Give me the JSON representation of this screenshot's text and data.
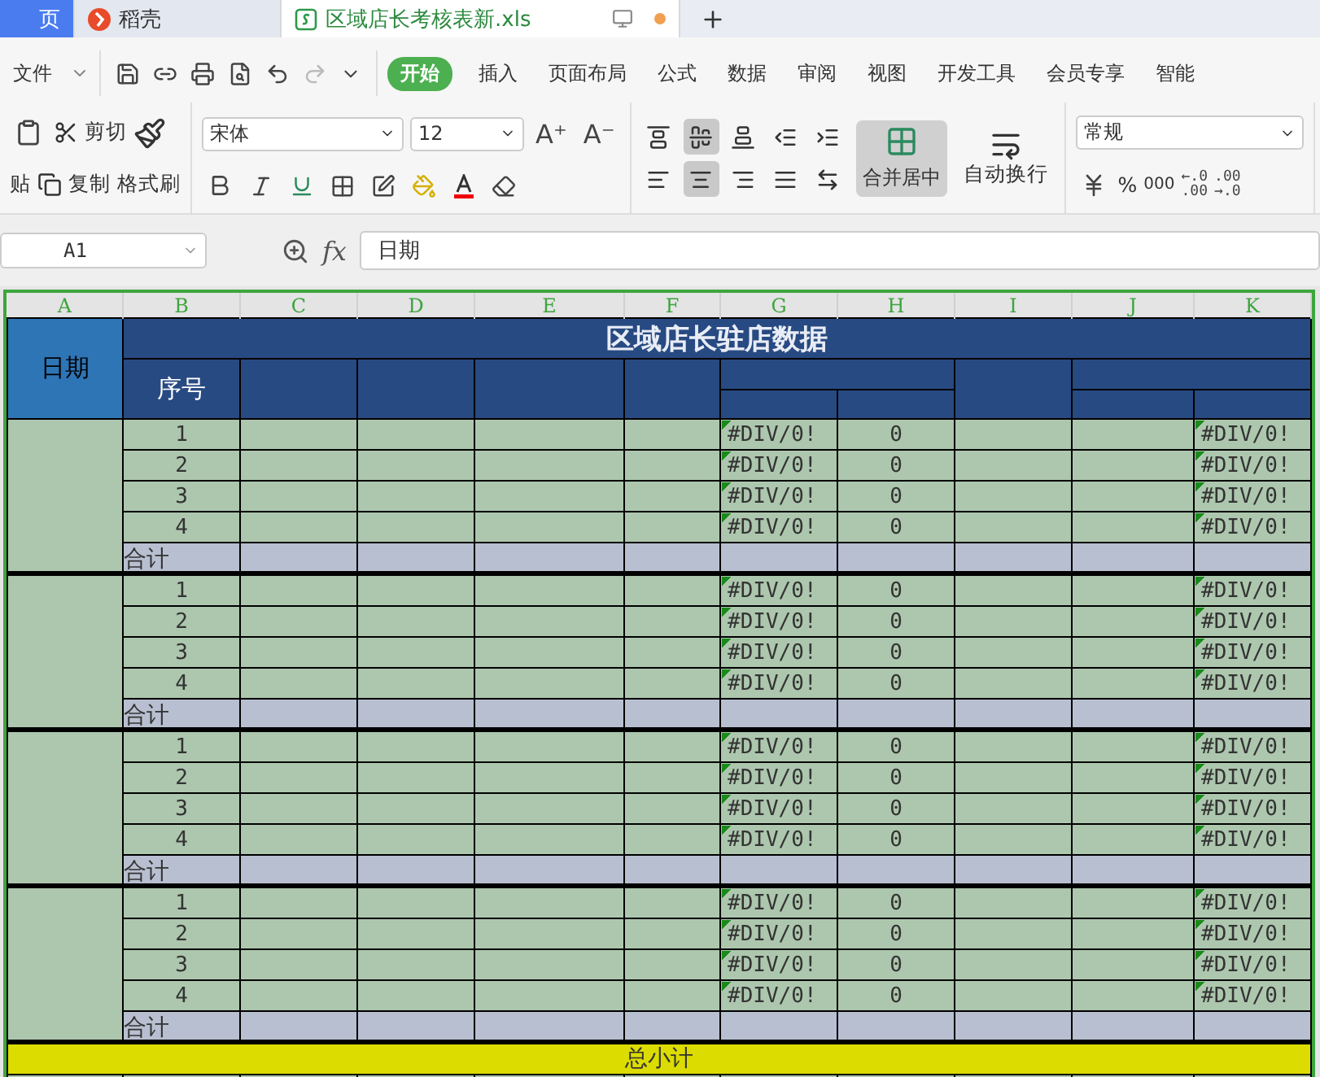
{
  "tabs": [
    {
      "label": "页",
      "kind": "home",
      "selected": false
    },
    {
      "label": "稻壳",
      "kind": "docer",
      "selected": false
    },
    {
      "label": "区域店长考核表新.xls",
      "kind": "sheet",
      "selected": true,
      "unsaved": true
    }
  ],
  "menu": {
    "file": "文件",
    "items": [
      {
        "label": "开始",
        "selected": true
      },
      {
        "label": "插入",
        "selected": false
      },
      {
        "label": "页面布局",
        "selected": false
      },
      {
        "label": "公式",
        "selected": false
      },
      {
        "label": "数据",
        "selected": false
      },
      {
        "label": "审阅",
        "selected": false
      },
      {
        "label": "视图",
        "selected": false
      },
      {
        "label": "开发工具",
        "selected": false
      },
      {
        "label": "会员专享",
        "selected": false
      },
      {
        "label": "智能",
        "selected": false
      }
    ]
  },
  "ribbon": {
    "paste": "贴",
    "cut": "剪切",
    "copy": "复制",
    "format_painter": "格式刷",
    "font": "宋体",
    "size": "12",
    "font_grow": "A⁺",
    "font_shrink": "A⁻",
    "merge": "合并居中",
    "wrap": "自动换行",
    "number_format": "常规",
    "percent": "%",
    "thousands": "000",
    "align_top": [
      {
        "kind": "top",
        "selected": false
      },
      {
        "kind": "middle",
        "selected": true
      },
      {
        "kind": "bottom",
        "selected": false
      },
      {
        "kind": "outdent",
        "selected": false
      },
      {
        "kind": "indent",
        "selected": false
      }
    ],
    "align_bottom": [
      {
        "kind": "left",
        "selected": false
      },
      {
        "kind": "center",
        "selected": true
      },
      {
        "kind": "right",
        "selected": false
      },
      {
        "kind": "justify",
        "selected": false
      },
      {
        "kind": "distribute",
        "selected": false
      }
    ],
    "decimals": [
      {
        "top": "←.0",
        "bottom": ".00"
      },
      {
        "top": ".00",
        "bottom": "→.0"
      }
    ]
  },
  "formula_bar": {
    "cell": "A1",
    "fx": "fx",
    "value": "日期"
  },
  "columns": [
    "A",
    "B",
    "C",
    "D",
    "E",
    "F",
    "G",
    "H",
    "I",
    "J",
    "K"
  ],
  "sheet": {
    "date_header": "日期",
    "title": "区域店长驻店数据",
    "seq_header": "序号",
    "groups": [
      {
        "rows": [
          {
            "seq": "1",
            "g": "#DIV/0!",
            "h": "0",
            "k": "#DIV/0!"
          },
          {
            "seq": "2",
            "g": "#DIV/0!",
            "h": "0",
            "k": "#DIV/0!"
          },
          {
            "seq": "3",
            "g": "#DIV/0!",
            "h": "0",
            "k": "#DIV/0!"
          },
          {
            "seq": "4",
            "g": "#DIV/0!",
            "h": "0",
            "k": "#DIV/0!"
          }
        ],
        "subtotal": "合计"
      },
      {
        "rows": [
          {
            "seq": "1",
            "g": "#DIV/0!",
            "h": "0",
            "k": "#DIV/0!"
          },
          {
            "seq": "2",
            "g": "#DIV/0!",
            "h": "0",
            "k": "#DIV/0!"
          },
          {
            "seq": "3",
            "g": "#DIV/0!",
            "h": "0",
            "k": "#DIV/0!"
          },
          {
            "seq": "4",
            "g": "#DIV/0!",
            "h": "0",
            "k": "#DIV/0!"
          }
        ],
        "subtotal": "合计"
      },
      {
        "rows": [
          {
            "seq": "1",
            "g": "#DIV/0!",
            "h": "0",
            "k": "#DIV/0!"
          },
          {
            "seq": "2",
            "g": "#DIV/0!",
            "h": "0",
            "k": "#DIV/0!"
          },
          {
            "seq": "3",
            "g": "#DIV/0!",
            "h": "0",
            "k": "#DIV/0!"
          },
          {
            "seq": "4",
            "g": "#DIV/0!",
            "h": "0",
            "k": "#DIV/0!"
          }
        ],
        "subtotal": "合计"
      },
      {
        "rows": [
          {
            "seq": "1",
            "g": "#DIV/0!",
            "h": "0",
            "k": "#DIV/0!"
          },
          {
            "seq": "2",
            "g": "#DIV/0!",
            "h": "0",
            "k": "#DIV/0!"
          },
          {
            "seq": "3",
            "g": "#DIV/0!",
            "h": "0",
            "k": "#DIV/0!"
          },
          {
            "seq": "4",
            "g": "#DIV/0!",
            "h": "0",
            "k": "#DIV/0!"
          }
        ],
        "subtotal": "合计"
      }
    ],
    "total": "总小计"
  }
}
